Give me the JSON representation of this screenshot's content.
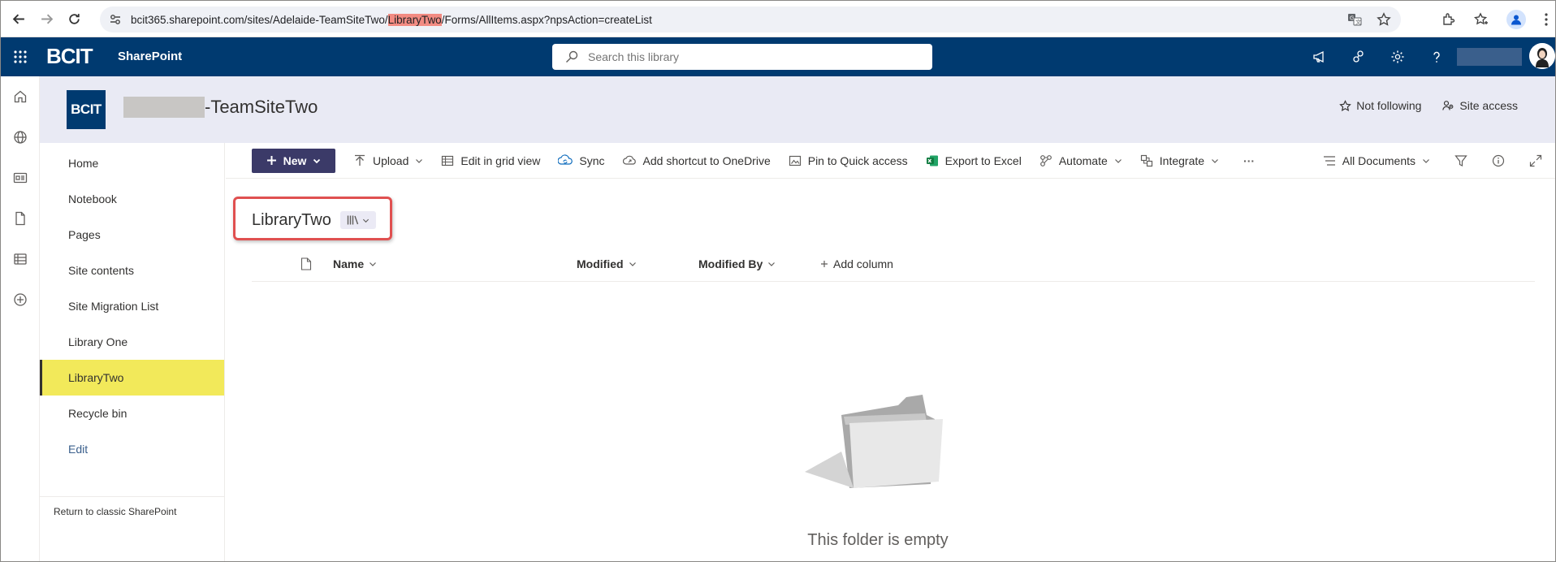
{
  "browser": {
    "url_prefix": "bcit365.sharepoint.com/sites/Adelaide-TeamSiteTwo/",
    "url_highlight": "LibraryTwo",
    "url_suffix": "/Forms/AllItems.aspx?npsAction=createList"
  },
  "suite": {
    "brand": "BCIT",
    "app_name": "SharePoint",
    "search_placeholder": "Search this library"
  },
  "site": {
    "logo_text": "BCIT",
    "title_suffix": "-TeamSiteTwo",
    "not_following": "Not following",
    "site_access": "Site access"
  },
  "nav": {
    "items": [
      {
        "label": "Home"
      },
      {
        "label": "Notebook"
      },
      {
        "label": "Pages"
      },
      {
        "label": "Site contents"
      },
      {
        "label": "Site Migration List"
      },
      {
        "label": "Library One"
      },
      {
        "label": "LibraryTwo"
      },
      {
        "label": "Recycle bin"
      }
    ],
    "edit": "Edit",
    "classic": "Return to classic SharePoint"
  },
  "commands": {
    "new": "New",
    "upload": "Upload",
    "grid": "Edit in grid view",
    "sync": "Sync",
    "shortcut": "Add shortcut to OneDrive",
    "pin": "Pin to Quick access",
    "excel": "Export to Excel",
    "automate": "Automate",
    "integrate": "Integrate",
    "more": "···",
    "view": "All Documents"
  },
  "library": {
    "title": "LibraryTwo",
    "columns": {
      "name": "Name",
      "modified": "Modified",
      "modified_by": "Modified By",
      "add": "Add column"
    },
    "empty_message": "This folder is empty"
  },
  "colors": {
    "suite_bar": "#003a70",
    "site_header": "#e9eaf4",
    "active_nav": "#f2e95a",
    "new_button": "#3b3a68",
    "highlight_box": "#e05050"
  }
}
